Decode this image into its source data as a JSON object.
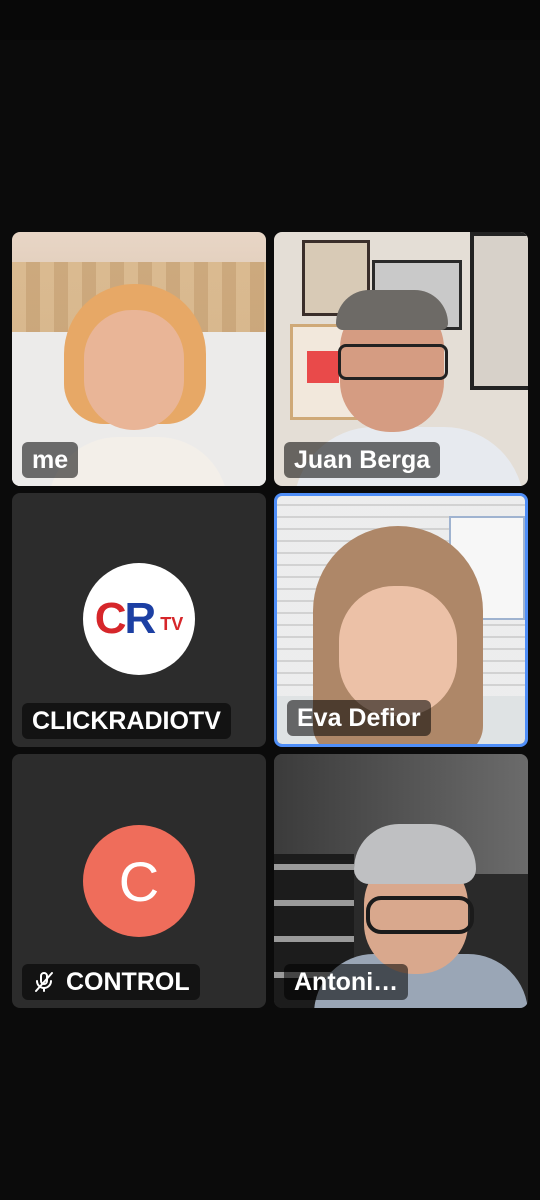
{
  "participants": [
    {
      "name": "me",
      "type": "video"
    },
    {
      "name": "Juan Berga",
      "type": "video"
    },
    {
      "name": "CLICKRADIOTV",
      "type": "avatar",
      "avatar_text": "CR",
      "avatar_suffix": "TV",
      "colors": {
        "c": "#d6262a",
        "r": "#1c3fa3",
        "tv": "#d6262a"
      }
    },
    {
      "name": "Eva Defior",
      "type": "video",
      "active_speaker": true
    },
    {
      "name": "CONTROL",
      "type": "avatar",
      "avatar_text": "C",
      "muted": true,
      "avatar_color": "#ef6d5b"
    },
    {
      "name": "Antoni…",
      "type": "video"
    }
  ],
  "colors": {
    "background": "#0b0b0b",
    "tile": "#2c2c2c",
    "active_border": "#4f8ef7"
  },
  "icons": {
    "mute": "microphone-off-icon"
  }
}
